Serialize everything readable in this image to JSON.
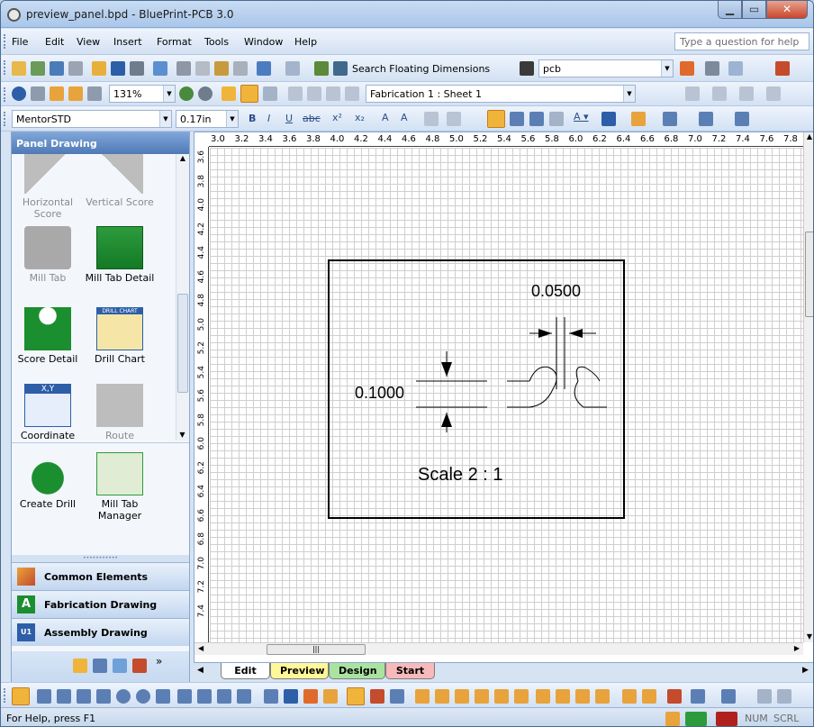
{
  "window": {
    "title": "preview_panel.bpd - BluePrint-PCB 3.0"
  },
  "menu": [
    "File",
    "Edit",
    "View",
    "Insert",
    "Format",
    "Tools",
    "Window",
    "Help"
  ],
  "help_box": {
    "placeholder": "Type a question for help"
  },
  "toolbar1": {
    "search_label": "Search Floating Dimensions",
    "search_value": "pcb"
  },
  "toolbar2": {
    "zoom": "131%",
    "sheet": "Fabrication 1 : Sheet 1"
  },
  "toolbar3": {
    "style": "MentorSTD",
    "size": "0.17in",
    "bold": "B",
    "italic": "I",
    "underline": "U",
    "strike": "abc"
  },
  "side_panel": {
    "title": "Panel Drawing",
    "items": [
      {
        "label": "Horizontal Score",
        "enabled": false
      },
      {
        "label": "Vertical Score",
        "enabled": false
      },
      {
        "label": "Mill Tab",
        "enabled": false
      },
      {
        "label": "Mill Tab Detail",
        "enabled": true
      },
      {
        "label": "Score Detail",
        "enabled": true
      },
      {
        "label": "Drill Chart",
        "enabled": true
      },
      {
        "label": "Coordinate",
        "enabled": true
      },
      {
        "label": "Route",
        "enabled": false
      },
      {
        "label": "Create Drill",
        "enabled": true
      },
      {
        "label": "Mill Tab Manager",
        "enabled": true
      }
    ],
    "drill_chart_header": "DRILL CHART",
    "coordinate_header": "X,Y",
    "categories": [
      "Common Elements",
      "Fabrication Drawing",
      "Assembly Drawing"
    ],
    "category_icons": [
      "A",
      "U1"
    ]
  },
  "ruler": {
    "h": [
      "3.0",
      "3.2",
      "3.4",
      "3.6",
      "3.8",
      "4.0",
      "4.2",
      "4.4",
      "4.6",
      "4.8",
      "5.0",
      "5.2",
      "5.4",
      "5.6",
      "5.8",
      "6.0",
      "6.2",
      "6.4",
      "6.6",
      "6.8",
      "7.0",
      "7.2",
      "7.4",
      "7.6",
      "7.8"
    ],
    "v": [
      "3.6",
      "3.8",
      "4.0",
      "4.2",
      "4.4",
      "4.6",
      "4.8",
      "5.0",
      "5.2",
      "5.4",
      "5.6",
      "5.8",
      "6.0",
      "6.2",
      "6.4",
      "6.6",
      "6.8",
      "7.0",
      "7.2",
      "7.4"
    ]
  },
  "drawing": {
    "dim_top": "0.0500",
    "dim_left": "0.1000",
    "scale": "Scale 2 : 1"
  },
  "tabs": [
    {
      "label": "Edit",
      "color": "#ffffff"
    },
    {
      "label": "Preview",
      "color": "#fff899"
    },
    {
      "label": "Design",
      "color": "#a9e39f"
    },
    {
      "label": "Start",
      "color": "#f7b9b9"
    }
  ],
  "status": {
    "text": "For Help, press F1",
    "num": "NUM",
    "scrl": "SCRL"
  }
}
